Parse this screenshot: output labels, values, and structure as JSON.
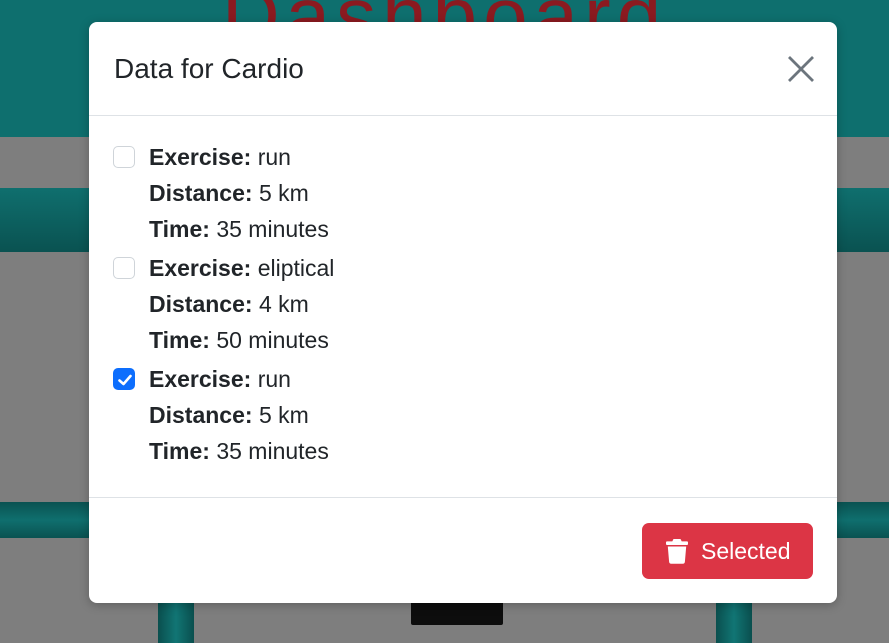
{
  "background": {
    "title": "Dashboard"
  },
  "modal": {
    "title": "Data for Cardio",
    "close_icon": "close-icon",
    "entries": [
      {
        "checked": false,
        "exercise_label": "Exercise:",
        "exercise": "run",
        "distance_label": "Distance:",
        "distance": "5 km",
        "time_label": "Time:",
        "time": "35 minutes"
      },
      {
        "checked": false,
        "exercise_label": "Exercise:",
        "exercise": "eliptical",
        "distance_label": "Distance:",
        "distance": "4 km",
        "time_label": "Time:",
        "time": "50 minutes"
      },
      {
        "checked": true,
        "exercise_label": "Exercise:",
        "exercise": "run",
        "distance_label": "Distance:",
        "distance": "5 km",
        "time_label": "Time:",
        "time": "35 minutes"
      }
    ],
    "delete_button": {
      "icon": "trash-icon",
      "label": "Selected"
    }
  },
  "colors": {
    "danger": "#dc3545",
    "checkbox_checked": "#0d6efd",
    "teal": "#0e6f6e"
  }
}
